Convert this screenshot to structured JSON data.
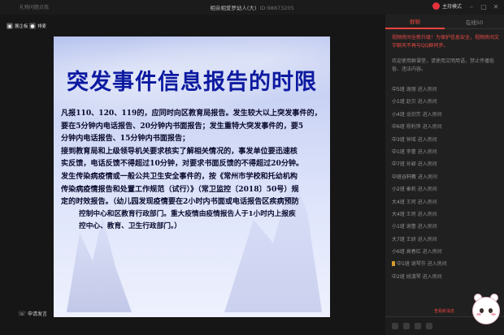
{
  "window": {
    "left_title": "礼物问题点我",
    "title": "相亲相爱罗幼人(大)",
    "room_id": "ID:98873205",
    "host_mode": "主持模式",
    "controls": [
      "minimize",
      "maximize",
      "close"
    ]
  },
  "left_toolbar": {
    "items": [
      {
        "label": "展企板",
        "icon": "board-icon"
      },
      {
        "label": "排麦",
        "icon": "mic-queue-icon"
      }
    ],
    "apply_speak": "申请发言"
  },
  "slide": {
    "title": "突发事件信息报告的时限",
    "lines": [
      "凡报110、120、119的，应同时向区教育局报告。发生较大以上突发事件的，",
      "要在5分钟内电话报告、20分钟内书面报告；发生重特大突发事件的，要5",
      "分钟内电话报告、15分钟内书面报告；",
      "接到教育局和上级领导机关要求核实了解相关情况的，事发单位要迅速核",
      "实反馈，电话反馈不得超过10分钟，对要求书面反馈的不得超过20分钟。",
      "发生传染病疫情或一般公共卫生安全事件的，按《常州市学校和托幼机构",
      "传染病疫情报告和处置工作规范（试行）》（常卫监控〔2018〕50号）规",
      "定的时效报告。（幼儿园发现疫情要在2小时内书面或电话报告区疾病预防",
      "控制中心和区教育行政部门。重大疫情由疫情报告人于1小时内上报疾",
      "控中心、教育、卫生行政部门。）"
    ]
  },
  "right_panel": {
    "tabs": [
      {
        "label": "群聊",
        "active": true
      },
      {
        "label": "在线50",
        "active": false
      }
    ],
    "notice": "视频房间全新升级！为保护信息安全，视频房间文字聊天不再与QQ群同步。",
    "welcome": "欢迎使用群课堂，请使用文明用语，禁止传播低俗、违法内容。",
    "messages": [
      {
        "name": "中5班",
        "text": "谢丽 进入房间",
        "badge": false
      },
      {
        "name": "小1班",
        "text": "赵贝 进入房间",
        "badge": false
      },
      {
        "name": "小4班",
        "text": "龙剑芳 进入房间",
        "badge": false
      },
      {
        "name": "中6班",
        "text": "杨利萍 进入房间",
        "badge": false
      },
      {
        "name": "中3班",
        "text": "钟瑶 进入房间",
        "badge": false
      },
      {
        "name": "中1班",
        "text": "李蕾 进入房间",
        "badge": false
      },
      {
        "name": "中7班",
        "text": "孙颖 进入房间",
        "badge": false
      },
      {
        "name": "中班谷轩教",
        "text": "进入房间",
        "badge": false
      },
      {
        "name": "小2班",
        "text": "秦莉 进入房间",
        "badge": false
      },
      {
        "name": "大4班",
        "text": "王珂 进入房间",
        "badge": false
      },
      {
        "name": "大4班",
        "text": "王珂 进入房间",
        "badge": false
      },
      {
        "name": "小1班",
        "text": "谢蕾 进入房间",
        "badge": false
      },
      {
        "name": "大7班",
        "text": "王妍 进入房间",
        "badge": false
      },
      {
        "name": "小6班",
        "text": "高春红 进入房间",
        "badge": false
      },
      {
        "name": "中1班",
        "text": "谢琴芬 进入房间",
        "badge": true
      },
      {
        "name": "中2班",
        "text": "姚漢琴 进入房间",
        "badge": false
      }
    ],
    "more_messages": "查看新消息",
    "composer_icons": [
      "emoji-icon",
      "image-icon",
      "flower-icon",
      "gift-icon"
    ]
  },
  "colors": {
    "accent": "#e8453c",
    "slide_title": "#0d1aa0",
    "background": "#161616"
  }
}
